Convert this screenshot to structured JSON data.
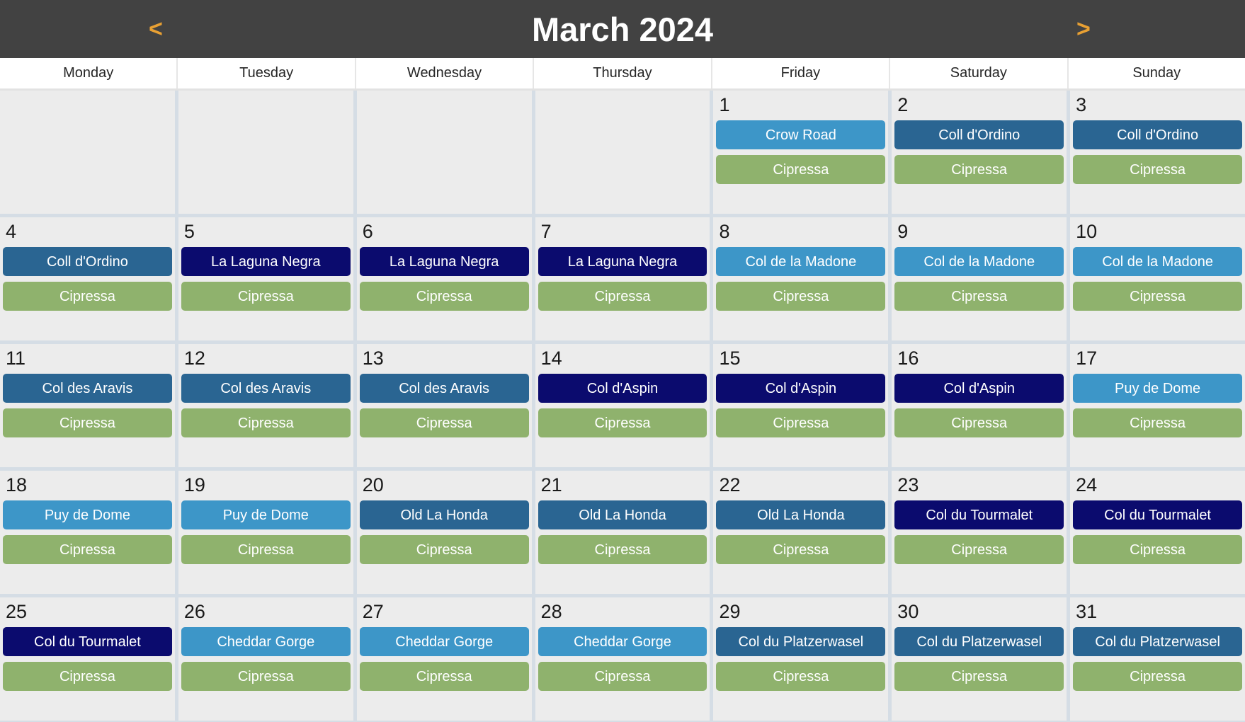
{
  "header": {
    "title": "March 2024",
    "prev_label": "<",
    "next_label": ">",
    "bar_color": "#424242",
    "arrow_color": "#e8a033",
    "title_color": "#ffffff"
  },
  "weekdays": [
    {
      "label": "Monday"
    },
    {
      "label": "Tuesday"
    },
    {
      "label": "Wednesday"
    },
    {
      "label": "Thursday"
    },
    {
      "label": "Friday"
    },
    {
      "label": "Saturday"
    },
    {
      "label": "Sunday"
    }
  ],
  "event_colors": {
    "light_blue": "#3d96c8",
    "steel_blue": "#2a6592",
    "navy": "#0b0b6e",
    "green": "#8fb26d"
  },
  "grid": {
    "cell_background": "#ececec",
    "separator_color": "#d5dde5",
    "weeks": [
      {
        "days": [
          {
            "number": "",
            "blank": true,
            "events": []
          },
          {
            "number": "",
            "blank": true,
            "events": []
          },
          {
            "number": "",
            "blank": true,
            "events": []
          },
          {
            "number": "",
            "blank": true,
            "events": []
          },
          {
            "number": "1",
            "blank": false,
            "events": [
              {
                "label": "Crow Road",
                "color": "#3d96c8"
              },
              {
                "label": "Cipressa",
                "color": "#8fb26d"
              }
            ]
          },
          {
            "number": "2",
            "blank": false,
            "events": [
              {
                "label": "Coll d'Ordino",
                "color": "#2a6592"
              },
              {
                "label": "Cipressa",
                "color": "#8fb26d"
              }
            ]
          },
          {
            "number": "3",
            "blank": false,
            "events": [
              {
                "label": "Coll d'Ordino",
                "color": "#2a6592"
              },
              {
                "label": "Cipressa",
                "color": "#8fb26d"
              }
            ]
          }
        ]
      },
      {
        "days": [
          {
            "number": "4",
            "blank": false,
            "events": [
              {
                "label": "Coll d'Ordino",
                "color": "#2a6592"
              },
              {
                "label": "Cipressa",
                "color": "#8fb26d"
              }
            ]
          },
          {
            "number": "5",
            "blank": false,
            "events": [
              {
                "label": "La Laguna Negra",
                "color": "#0b0b6e"
              },
              {
                "label": "Cipressa",
                "color": "#8fb26d"
              }
            ]
          },
          {
            "number": "6",
            "blank": false,
            "events": [
              {
                "label": "La Laguna Negra",
                "color": "#0b0b6e"
              },
              {
                "label": "Cipressa",
                "color": "#8fb26d"
              }
            ]
          },
          {
            "number": "7",
            "blank": false,
            "events": [
              {
                "label": "La Laguna Negra",
                "color": "#0b0b6e"
              },
              {
                "label": "Cipressa",
                "color": "#8fb26d"
              }
            ]
          },
          {
            "number": "8",
            "blank": false,
            "events": [
              {
                "label": "Col de la Madone",
                "color": "#3d96c8"
              },
              {
                "label": "Cipressa",
                "color": "#8fb26d"
              }
            ]
          },
          {
            "number": "9",
            "blank": false,
            "events": [
              {
                "label": "Col de la Madone",
                "color": "#3d96c8"
              },
              {
                "label": "Cipressa",
                "color": "#8fb26d"
              }
            ]
          },
          {
            "number": "10",
            "blank": false,
            "events": [
              {
                "label": "Col de la Madone",
                "color": "#3d96c8"
              },
              {
                "label": "Cipressa",
                "color": "#8fb26d"
              }
            ]
          }
        ]
      },
      {
        "days": [
          {
            "number": "11",
            "blank": false,
            "events": [
              {
                "label": "Col des Aravis",
                "color": "#2a6592"
              },
              {
                "label": "Cipressa",
                "color": "#8fb26d"
              }
            ]
          },
          {
            "number": "12",
            "blank": false,
            "events": [
              {
                "label": "Col des Aravis",
                "color": "#2a6592"
              },
              {
                "label": "Cipressa",
                "color": "#8fb26d"
              }
            ]
          },
          {
            "number": "13",
            "blank": false,
            "events": [
              {
                "label": "Col des Aravis",
                "color": "#2a6592"
              },
              {
                "label": "Cipressa",
                "color": "#8fb26d"
              }
            ]
          },
          {
            "number": "14",
            "blank": false,
            "events": [
              {
                "label": "Col d'Aspin",
                "color": "#0b0b6e"
              },
              {
                "label": "Cipressa",
                "color": "#8fb26d"
              }
            ]
          },
          {
            "number": "15",
            "blank": false,
            "events": [
              {
                "label": "Col d'Aspin",
                "color": "#0b0b6e"
              },
              {
                "label": "Cipressa",
                "color": "#8fb26d"
              }
            ]
          },
          {
            "number": "16",
            "blank": false,
            "events": [
              {
                "label": "Col d'Aspin",
                "color": "#0b0b6e"
              },
              {
                "label": "Cipressa",
                "color": "#8fb26d"
              }
            ]
          },
          {
            "number": "17",
            "blank": false,
            "events": [
              {
                "label": "Puy de Dome",
                "color": "#3d96c8"
              },
              {
                "label": "Cipressa",
                "color": "#8fb26d"
              }
            ]
          }
        ]
      },
      {
        "days": [
          {
            "number": "18",
            "blank": false,
            "events": [
              {
                "label": "Puy de Dome",
                "color": "#3d96c8"
              },
              {
                "label": "Cipressa",
                "color": "#8fb26d"
              }
            ]
          },
          {
            "number": "19",
            "blank": false,
            "events": [
              {
                "label": "Puy de Dome",
                "color": "#3d96c8"
              },
              {
                "label": "Cipressa",
                "color": "#8fb26d"
              }
            ]
          },
          {
            "number": "20",
            "blank": false,
            "events": [
              {
                "label": "Old La Honda",
                "color": "#2a6592"
              },
              {
                "label": "Cipressa",
                "color": "#8fb26d"
              }
            ]
          },
          {
            "number": "21",
            "blank": false,
            "events": [
              {
                "label": "Old La Honda",
                "color": "#2a6592"
              },
              {
                "label": "Cipressa",
                "color": "#8fb26d"
              }
            ]
          },
          {
            "number": "22",
            "blank": false,
            "events": [
              {
                "label": "Old La Honda",
                "color": "#2a6592"
              },
              {
                "label": "Cipressa",
                "color": "#8fb26d"
              }
            ]
          },
          {
            "number": "23",
            "blank": false,
            "events": [
              {
                "label": "Col du Tourmalet",
                "color": "#0b0b6e"
              },
              {
                "label": "Cipressa",
                "color": "#8fb26d"
              }
            ]
          },
          {
            "number": "24",
            "blank": false,
            "events": [
              {
                "label": "Col du Tourmalet",
                "color": "#0b0b6e"
              },
              {
                "label": "Cipressa",
                "color": "#8fb26d"
              }
            ]
          }
        ]
      },
      {
        "days": [
          {
            "number": "25",
            "blank": false,
            "events": [
              {
                "label": "Col du Tourmalet",
                "color": "#0b0b6e"
              },
              {
                "label": "Cipressa",
                "color": "#8fb26d"
              }
            ]
          },
          {
            "number": "26",
            "blank": false,
            "events": [
              {
                "label": "Cheddar Gorge",
                "color": "#3d96c8"
              },
              {
                "label": "Cipressa",
                "color": "#8fb26d"
              }
            ]
          },
          {
            "number": "27",
            "blank": false,
            "events": [
              {
                "label": "Cheddar Gorge",
                "color": "#3d96c8"
              },
              {
                "label": "Cipressa",
                "color": "#8fb26d"
              }
            ]
          },
          {
            "number": "28",
            "blank": false,
            "events": [
              {
                "label": "Cheddar Gorge",
                "color": "#3d96c8"
              },
              {
                "label": "Cipressa",
                "color": "#8fb26d"
              }
            ]
          },
          {
            "number": "29",
            "blank": false,
            "events": [
              {
                "label": "Col du Platzerwasel",
                "color": "#2a6592"
              },
              {
                "label": "Cipressa",
                "color": "#8fb26d"
              }
            ]
          },
          {
            "number": "30",
            "blank": false,
            "events": [
              {
                "label": "Col du Platzerwasel",
                "color": "#2a6592"
              },
              {
                "label": "Cipressa",
                "color": "#8fb26d"
              }
            ]
          },
          {
            "number": "31",
            "blank": false,
            "events": [
              {
                "label": "Col du Platzerwasel",
                "color": "#2a6592"
              },
              {
                "label": "Cipressa",
                "color": "#8fb26d"
              }
            ]
          }
        ]
      }
    ]
  }
}
